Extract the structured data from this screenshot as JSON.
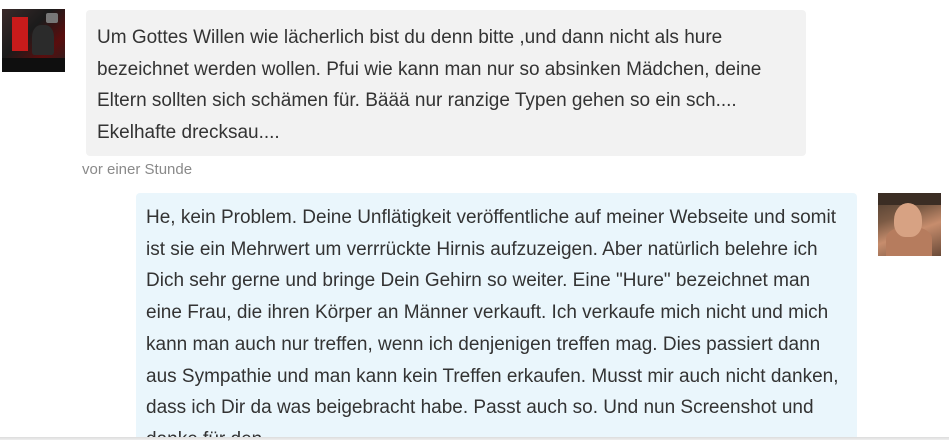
{
  "messages": [
    {
      "side": "left",
      "avatar_icon": "user-avatar-photo",
      "text": "Um Gottes Willen wie lächerlich bist du denn bitte ,und dann nicht als hure bezeichnet werden wollen. Pfui wie kann man nur so absinken Mädchen, deine Eltern sollten sich schämen für. Bäää nur ranzige Typen gehen so ein sch.... Ekelhafte drecksau....",
      "timestamp": "vor einer Stunde"
    },
    {
      "side": "right",
      "avatar_icon": "user-avatar-photo",
      "text": "He, kein Problem. Deine Unflätigkeit veröffentliche auf meiner Webseite und somit ist sie ein Mehrwert um verrrückte Hirnis aufzuzeigen. Aber natürlich belehre ich Dich sehr gerne und bringe Dein Gehirn so weiter. Eine \"Hure\" bezeichnet man eine Frau, die ihren Körper an Männer verkauft. Ich verkaufe mich nicht und mich kann man auch nur treffen, wenn ich denjenigen treffen mag. Dies passiert dann aus Sympathie und man kann kein Treffen erkaufen. Musst mir auch nicht danken, dass ich Dir da was beigebracht habe. Passt auch so. Und nun Screenshot und danke für den"
    }
  ],
  "colors": {
    "incoming_bubble": "#f2f2f2",
    "outgoing_bubble": "#eaf6fc",
    "message_text": "#333333",
    "timestamp_text": "#8a8a8a"
  }
}
